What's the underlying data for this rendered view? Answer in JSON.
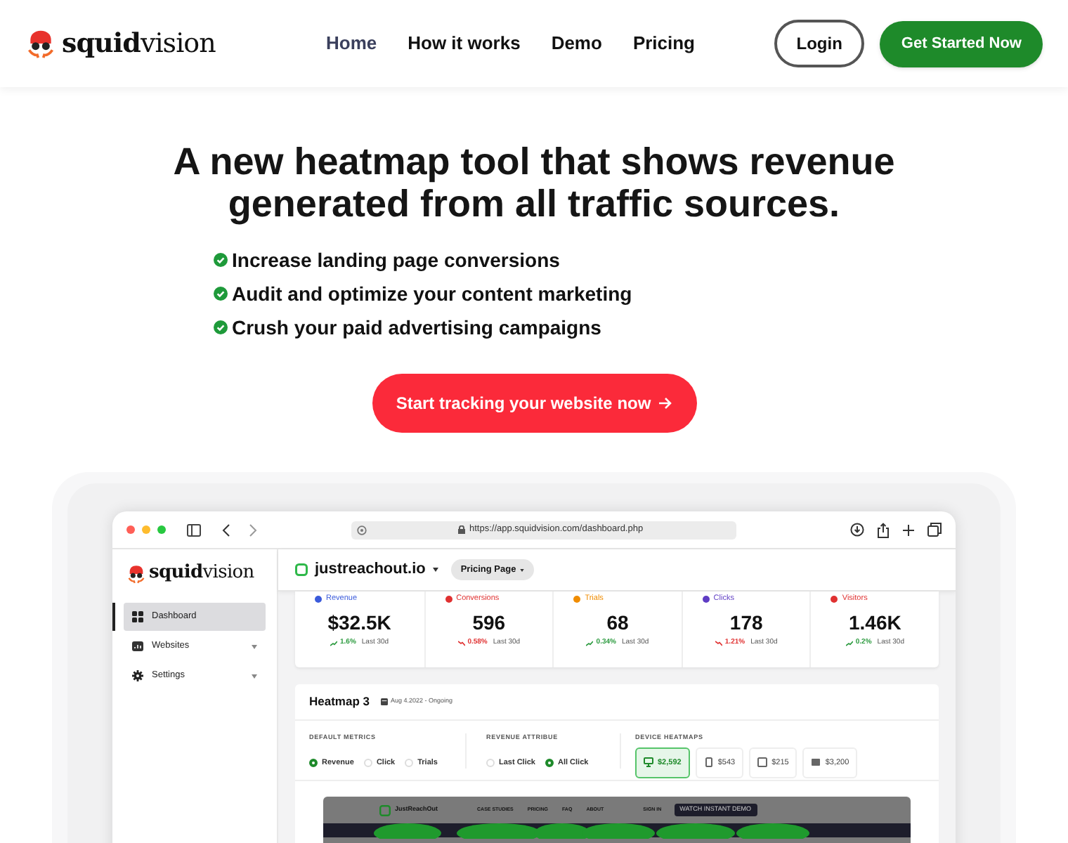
{
  "nav": {
    "logo": "**squid**vision",
    "links": [
      {
        "label": "Home",
        "selected": true
      },
      {
        "label": "How it works",
        "selected": false
      },
      {
        "label": "Demo",
        "selected": false
      },
      {
        "label": "Pricing",
        "selected": false
      }
    ],
    "login": "Login",
    "cta": "Get Started Now"
  },
  "hero": {
    "title": "A new heatmap tool that shows revenue generated from all traffic sources.",
    "bullets": [
      "Increase landing page conversions",
      "Audit and optimize your content marketing",
      "Crush your paid advertising campaigns"
    ],
    "cta": "Start tracking your website now"
  },
  "browser": {
    "url": "https://app.squidvision.com/dashboard.php",
    "app": {
      "logo": "**squid**vision",
      "site": "justreachout.io",
      "page": "Pricing Page",
      "sidebar": [
        {
          "label": "Dashboard",
          "selected": true,
          "kind": "grid",
          "expandable": false
        },
        {
          "label": "Websites",
          "selected": false,
          "kind": "site",
          "expandable": true
        },
        {
          "label": "Settings",
          "selected": false,
          "kind": "gear",
          "expandable": true
        }
      ],
      "metrics": [
        {
          "label": "Revenue",
          "color": "#3b5bdb",
          "value": "$32.5K",
          "change": "1.6%",
          "rising": true,
          "period": "Last 30d"
        },
        {
          "label": "Conversions",
          "color": "#e03131",
          "value": "596",
          "change": "0.58%",
          "rising": false,
          "period": "Last 30d"
        },
        {
          "label": "Trials",
          "color": "#f08c00",
          "value": "68",
          "change": "0.34%",
          "rising": true,
          "period": "Last 30d"
        },
        {
          "label": "Clicks",
          "color": "#5f3dc4",
          "value": "178",
          "change": "1.21%",
          "rising": false,
          "period": "Last 30d"
        },
        {
          "label": "Visitors",
          "color": "#e03131",
          "value": "1.46K",
          "change": "0.2%",
          "rising": true,
          "period": "Last 30d"
        }
      ],
      "heatmap": {
        "title": "Heatmap 3",
        "date": "Aug 4.2022 - Ongoing",
        "default_metrics": {
          "label": "DEFAULT METRICS",
          "options": [
            {
              "label": "Revenue",
              "selected": true
            },
            {
              "label": "Click",
              "selected": false
            },
            {
              "label": "Trials",
              "selected": false
            }
          ]
        },
        "revenue_attribute": {
          "label": "REVENUE ATTRIBUE",
          "options": [
            {
              "label": "Last Click",
              "selected": false
            },
            {
              "label": "All Click",
              "selected": true
            }
          ]
        },
        "device_heatmaps": {
          "label": "DEVICE HEATMAPS",
          "devices": [
            {
              "kind": "desktop",
              "value": "$2,592",
              "selected": true
            },
            {
              "kind": "phone",
              "value": "$543",
              "selected": false
            },
            {
              "kind": "tablet",
              "value": "$215",
              "selected": false
            },
            {
              "kind": "other",
              "value": "$3,200",
              "selected": false
            }
          ]
        },
        "preview": {
          "brand": "JustReachOut",
          "links": [
            "CASE STUDIES",
            "PRICING",
            "FAQ",
            "ABOUT"
          ],
          "sign_in": "SIGN IN",
          "demo": "WATCH INSTANT DEMO"
        }
      }
    }
  }
}
